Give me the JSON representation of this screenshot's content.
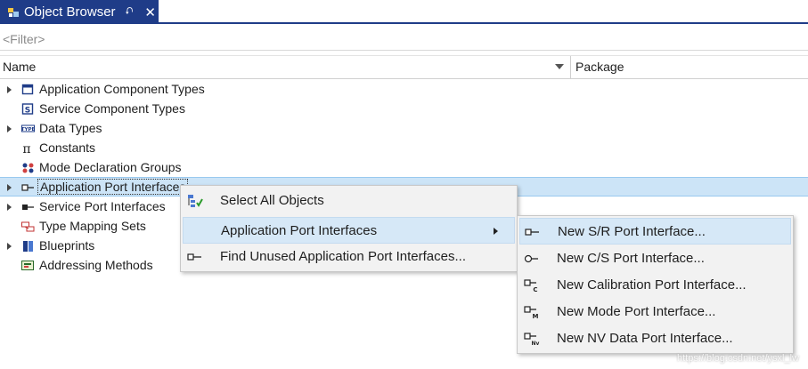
{
  "tab": {
    "title": "Object Browser",
    "pin_glyph": "⮏",
    "close_glyph": "✕"
  },
  "filter": {
    "placeholder": "<Filter>"
  },
  "columns": {
    "name": "Name",
    "package": "Package"
  },
  "tree": {
    "items": [
      {
        "label": "Application Component Types",
        "expandable": true,
        "icon": "window-icon"
      },
      {
        "label": "Service Component Types",
        "expandable": false,
        "icon": "service-component-icon"
      },
      {
        "label": "Data Types",
        "expandable": true,
        "icon": "type-icon"
      },
      {
        "label": "Constants",
        "expandable": false,
        "icon": "pi-icon"
      },
      {
        "label": "Mode Declaration Groups",
        "expandable": false,
        "icon": "mode-groups-icon"
      },
      {
        "label": "Application Port Interfaces",
        "expandable": true,
        "icon": "port-interface-icon",
        "selected": true
      },
      {
        "label": "Service Port Interfaces",
        "expandable": true,
        "icon": "service-port-icon"
      },
      {
        "label": "Type Mapping Sets",
        "expandable": false,
        "icon": "type-mapping-icon"
      },
      {
        "label": "Blueprints",
        "expandable": true,
        "icon": "blueprint-icon"
      },
      {
        "label": "Addressing Methods",
        "expandable": false,
        "icon": "addressing-icon"
      }
    ]
  },
  "context_menu": {
    "items": [
      {
        "label": "Select All Objects",
        "icon": "select-all-icon"
      },
      {
        "label": "Application Port Interfaces",
        "has_submenu": true,
        "highlighted": true
      },
      {
        "label": "Find Unused Application Port Interfaces...",
        "icon": "port-interface-icon"
      }
    ]
  },
  "submenu": {
    "items": [
      {
        "label": "New S/R Port Interface...",
        "icon": "sr-port-icon",
        "highlighted": true
      },
      {
        "label": "New C/S Port Interface...",
        "icon": "cs-port-icon"
      },
      {
        "label": "New Calibration Port Interface...",
        "icon": "calibration-port-icon"
      },
      {
        "label": "New Mode Port Interface...",
        "icon": "mode-port-icon"
      },
      {
        "label": "New NV Data Port Interface...",
        "icon": "nv-port-icon"
      }
    ]
  },
  "watermark": "https://blog.csdn.net/ysxl_lw",
  "colors": {
    "tab_bg": "#1f3c88",
    "selection_bg": "#cce4f7",
    "menu_highlight": "#d6e8f7"
  }
}
